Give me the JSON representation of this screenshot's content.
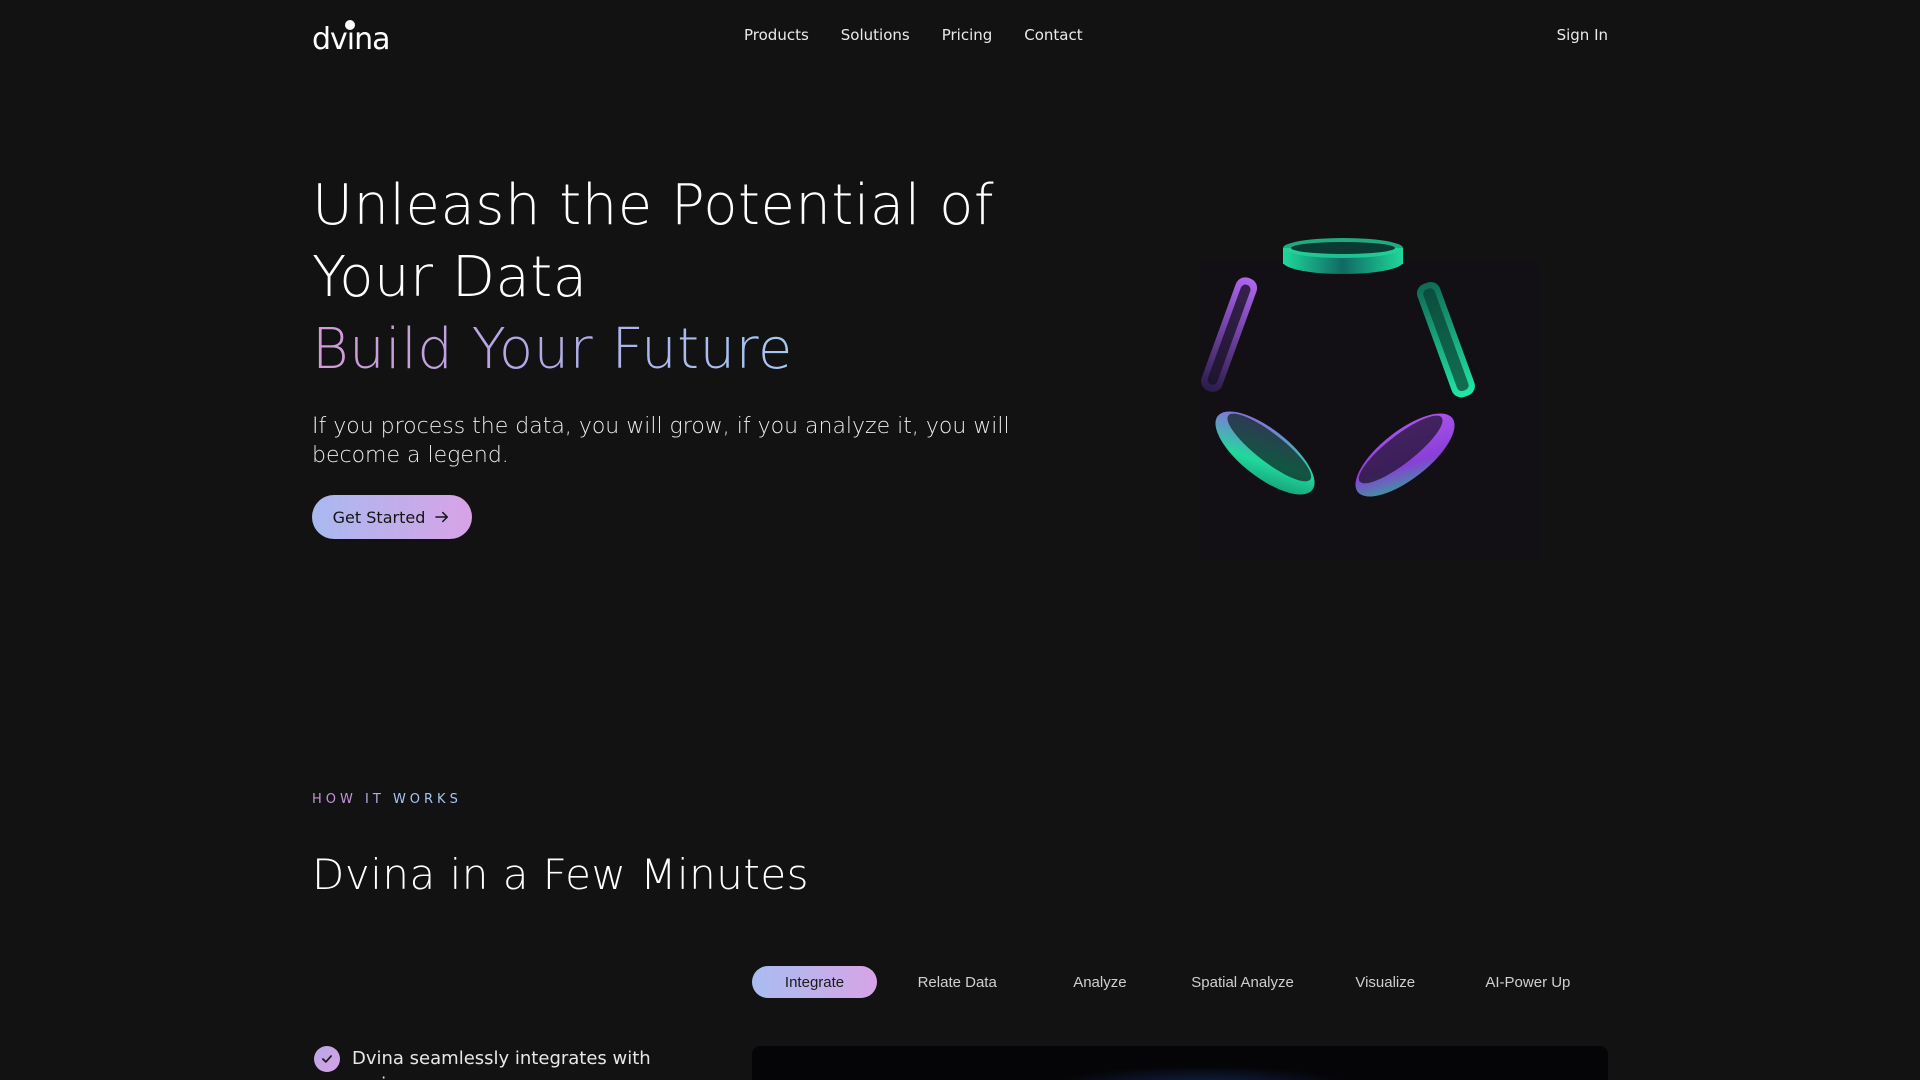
{
  "header": {
    "logo_text": "dvina",
    "nav": [
      "Products",
      "Solutions",
      "Pricing",
      "Contact"
    ],
    "signin_label": "Sign In"
  },
  "hero": {
    "title": "Unleash the Potential of Your Data",
    "subtitle": "Build Your Future",
    "description": "If you process the data, you will grow, if you analyze it, you will become a legend.",
    "cta_label": "Get Started"
  },
  "how_it_works": {
    "eyebrow": [
      "HOW",
      "IT",
      "WORKS"
    ],
    "title": "Dvina in a Few Minutes",
    "tabs": [
      "Integrate",
      "Relate Data",
      "Analyze",
      "Spatial Analyze",
      "Visualize",
      "AI-Power Up"
    ],
    "active_tab": "Integrate",
    "check_item": "Dvina seamlessly integrates with various"
  },
  "colors": {
    "background": "#121213",
    "accent_pink": "#d49ad8",
    "accent_blue": "#a6c8f2",
    "art_green": "#1fd89a",
    "art_purple": "#a84ff0"
  }
}
